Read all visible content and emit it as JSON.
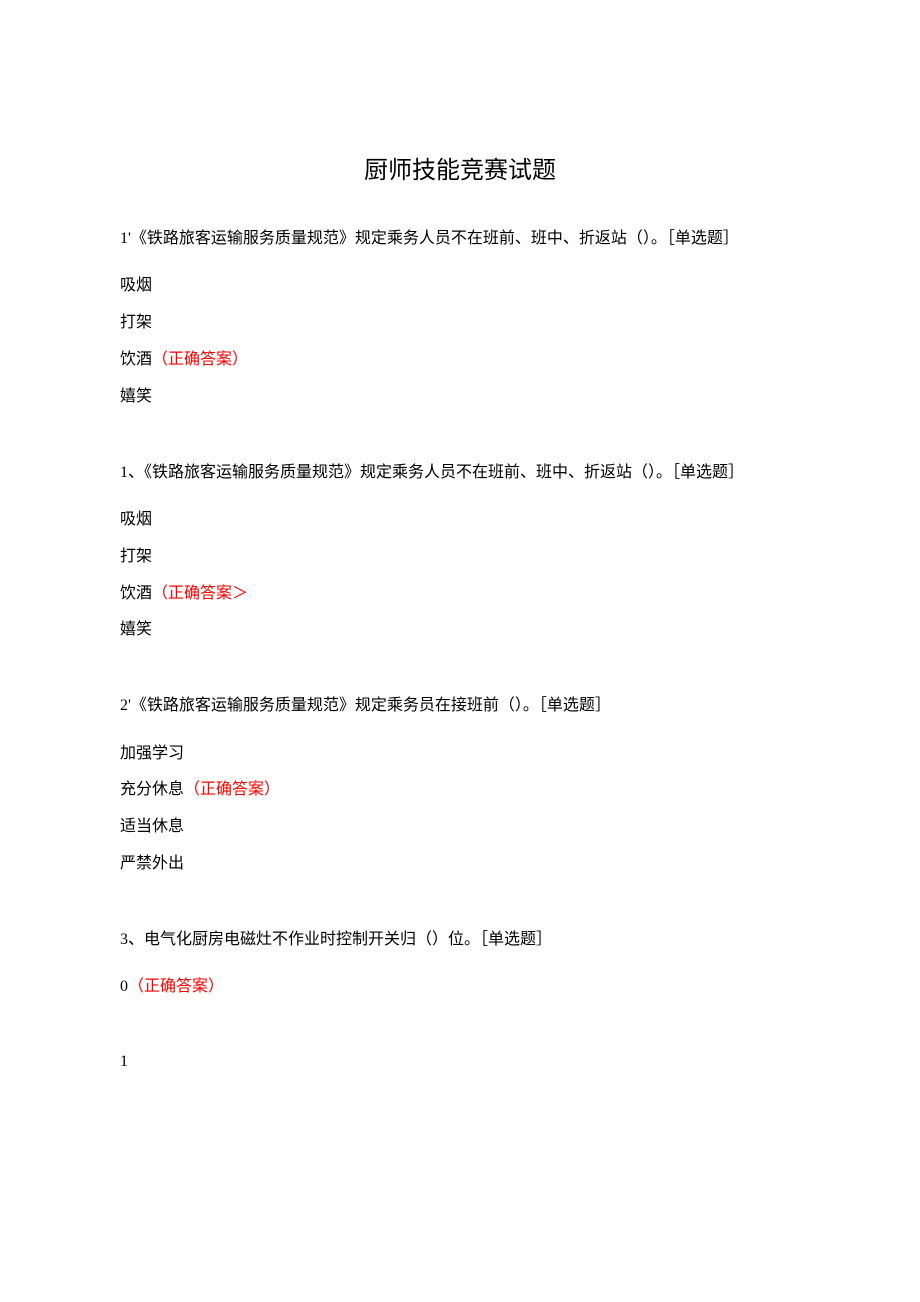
{
  "title": "厨师技能竞赛试题",
  "questions": [
    {
      "number": "1'",
      "text": "《铁路旅客运输服务质量规范》规定乘务人员不在班前、班中、折返站（）。［单选题］",
      "options": [
        {
          "text": "吸烟",
          "correct": false
        },
        {
          "text": "打架",
          "correct": false
        },
        {
          "text": "饮酒",
          "correct": true,
          "marker": "（正确答案）"
        },
        {
          "text": "嬉笑",
          "correct": false
        }
      ]
    },
    {
      "number": "1、",
      "text": "《铁路旅客运输服务质量规范》规定乘务人员不在班前、班中、折返站（）。［单选题］",
      "options": [
        {
          "text": "吸烟",
          "correct": false
        },
        {
          "text": "打架",
          "correct": false
        },
        {
          "text": "饮酒",
          "correct": true,
          "marker": "（正确答案＞"
        },
        {
          "text": "嬉笑",
          "correct": false
        }
      ]
    },
    {
      "number": "2'",
      "text": "《铁路旅客运输服务质量规范》规定乘务员在接班前（）。［单选题］",
      "options": [
        {
          "text": "加强学习",
          "correct": false
        },
        {
          "text": "充分休息",
          "correct": true,
          "marker": "（正确答案）"
        },
        {
          "text": "适当休息",
          "correct": false
        },
        {
          "text": "严禁外出",
          "correct": false
        }
      ]
    },
    {
      "number": "3、",
      "text": "电气化厨房电磁灶不作业时控制开关归（）位。［单选题］",
      "options": [
        {
          "text": "0",
          "correct": true,
          "marker": "（正确答案）"
        }
      ]
    }
  ],
  "trailing_option": "1"
}
